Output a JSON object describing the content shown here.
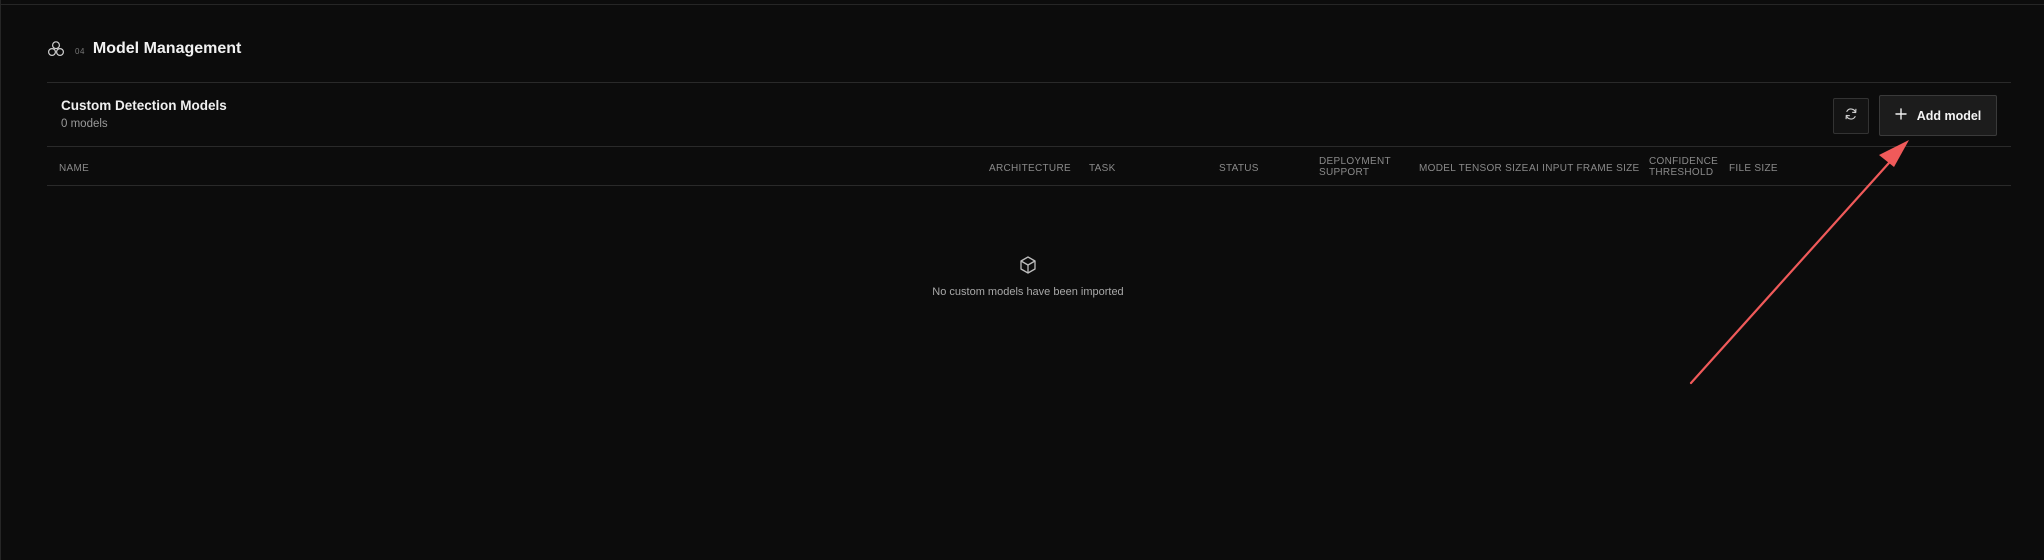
{
  "section": {
    "icon": "models-cluster-icon",
    "number": "04",
    "title": "Model Management"
  },
  "panel": {
    "title": "Custom Detection Models",
    "count": "0 models",
    "refresh_icon": "refresh-icon",
    "add_button_icon": "plus-icon",
    "add_button_label": "Add model"
  },
  "table": {
    "columns": {
      "name": "NAME",
      "architecture": "ARCHITECTURE",
      "task": "TASK",
      "status": "STATUS",
      "deployment_line1": "DEPLOYMENT",
      "deployment_line2": "SUPPORT",
      "model_tensor_size": "MODEL TENSOR SIZE",
      "ai_input_frame_size": "AI INPUT FRAME SIZE",
      "confidence_line1": "CONFIDENCE",
      "confidence_line2": "THRESHOLD",
      "file_size": "FILE SIZE"
    },
    "rows": []
  },
  "empty_state": {
    "icon": "box-icon",
    "message": "No custom models have been imported"
  },
  "annotation": {
    "type": "arrow",
    "color": "#f05a5a",
    "points_to": "add-model-button"
  }
}
